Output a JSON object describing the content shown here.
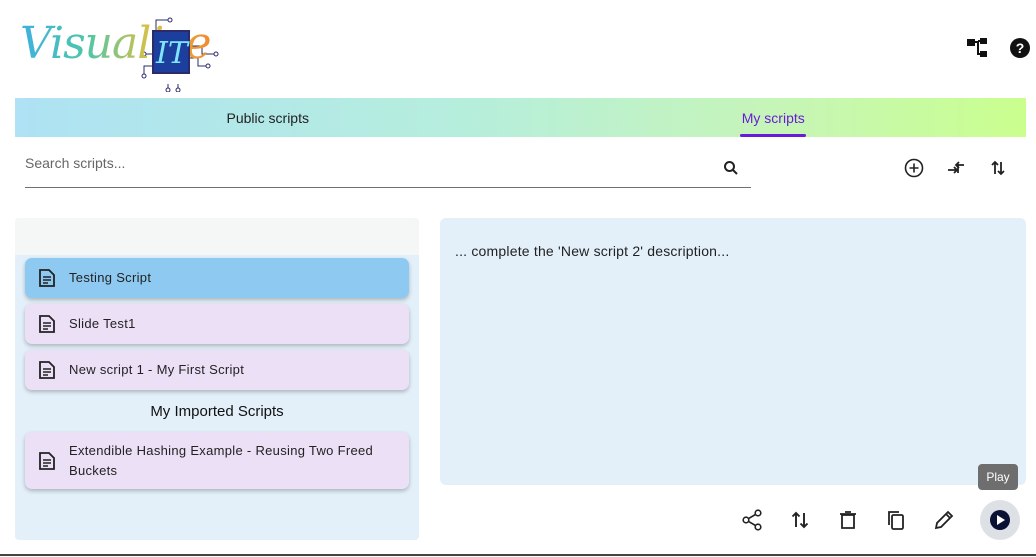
{
  "logo": {
    "text_script": "Visualize",
    "text_box": "IT"
  },
  "header": {
    "icons": [
      "tree-structure-icon",
      "help-icon"
    ]
  },
  "tabs": [
    {
      "label": "Public scripts",
      "active": false
    },
    {
      "label": "My scripts",
      "active": true
    }
  ],
  "search": {
    "placeholder": "Search scripts...",
    "value": ""
  },
  "toolbar": {
    "icons": [
      "add-circle-icon",
      "compare-arrows-icon",
      "sort-icon"
    ]
  },
  "scripts": [
    {
      "label": "Testing Script",
      "selected": true
    },
    {
      "label": "Slide Test1",
      "selected": false
    },
    {
      "label": "New script 1 - My First Script",
      "selected": false
    }
  ],
  "imported": {
    "heading": "My Imported Scripts",
    "items": [
      {
        "label": "Extendible Hashing Example - Reusing Two Freed Buckets"
      }
    ]
  },
  "description": {
    "text": "... complete the 'New script 2' description..."
  },
  "actions": {
    "icons": [
      "share-icon",
      "swap-vert-icon",
      "delete-icon",
      "copy-icon",
      "edit-icon",
      "play-icon"
    ]
  },
  "tooltip": {
    "text": "Play"
  },
  "colors": {
    "accent": "#6a1bd8",
    "selected_card": "#8ec9f2",
    "card": "#ece0f7",
    "panel": "#e3f0fa"
  }
}
